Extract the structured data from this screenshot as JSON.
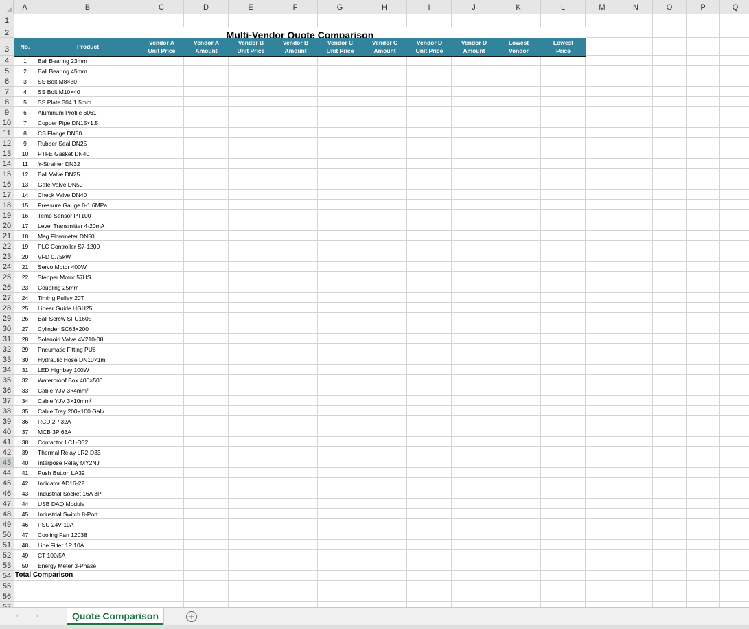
{
  "sheet": {
    "title": "Multi-Vendor Quote Comparison",
    "column_letters": [
      "A",
      "B",
      "C",
      "D",
      "E",
      "F",
      "G",
      "H",
      "I",
      "J",
      "K",
      "L",
      "M",
      "N",
      "O",
      "P",
      "Q"
    ],
    "selected_row": "43",
    "headers": [
      {
        "line1": "No.",
        "line2": ""
      },
      {
        "line1": "Product",
        "line2": ""
      },
      {
        "line1": "Vendor A",
        "line2": "Unit Price"
      },
      {
        "line1": "Vendor A",
        "line2": "Amount"
      },
      {
        "line1": "Vendor B",
        "line2": "Unit Price"
      },
      {
        "line1": "Vendor B",
        "line2": "Amount"
      },
      {
        "line1": "Vendor C",
        "line2": "Unit Price"
      },
      {
        "line1": "Vendor C",
        "line2": "Amount"
      },
      {
        "line1": "Vendor D",
        "line2": "Unit Price"
      },
      {
        "line1": "Vendor D",
        "line2": "Amount"
      },
      {
        "line1": "Lowest",
        "line2": "Vendor"
      },
      {
        "line1": "Lowest",
        "line2": "Price"
      }
    ],
    "products": [
      {
        "no": "1",
        "name": "Ball Bearing 23mm"
      },
      {
        "no": "2",
        "name": "Ball Bearing 45mm"
      },
      {
        "no": "3",
        "name": "SS Bolt M8×30"
      },
      {
        "no": "4",
        "name": "SS Bolt M10×40"
      },
      {
        "no": "5",
        "name": "SS Plate 304 1.5mm"
      },
      {
        "no": "6",
        "name": "Aluminum Profile 6061"
      },
      {
        "no": "7",
        "name": "Copper Pipe DN15×1.5"
      },
      {
        "no": "8",
        "name": "CS Flange DN50"
      },
      {
        "no": "9",
        "name": "Rubber Seal DN25"
      },
      {
        "no": "10",
        "name": "PTFE Gasket DN40"
      },
      {
        "no": "11",
        "name": "Y-Strainer DN32"
      },
      {
        "no": "12",
        "name": "Ball Valve DN25"
      },
      {
        "no": "13",
        "name": "Gate Valve DN50"
      },
      {
        "no": "14",
        "name": "Check Valve DN40"
      },
      {
        "no": "15",
        "name": "Pressure Gauge 0-1.6MPa"
      },
      {
        "no": "16",
        "name": "Temp Sensor PT100"
      },
      {
        "no": "17",
        "name": "Level Transmitter 4-20mA"
      },
      {
        "no": "18",
        "name": "Mag Flowmeter DN50"
      },
      {
        "no": "19",
        "name": "PLC Controller S7-1200"
      },
      {
        "no": "20",
        "name": "VFD 0.75kW"
      },
      {
        "no": "21",
        "name": "Servo Motor 400W"
      },
      {
        "no": "22",
        "name": "Stepper Motor 57HS"
      },
      {
        "no": "23",
        "name": "Coupling 25mm"
      },
      {
        "no": "24",
        "name": "Timing Pulley 20T"
      },
      {
        "no": "25",
        "name": "Linear Guide HGH25"
      },
      {
        "no": "26",
        "name": "Ball Screw SFU1605"
      },
      {
        "no": "27",
        "name": "Cylinder SC63×200"
      },
      {
        "no": "28",
        "name": "Solenoid Valve 4V210-08"
      },
      {
        "no": "29",
        "name": "Pneumatic Fitting PU8"
      },
      {
        "no": "30",
        "name": "Hydraulic Hose DN10×1m"
      },
      {
        "no": "31",
        "name": "LED Highbay 100W"
      },
      {
        "no": "32",
        "name": "Waterproof Box 400×500"
      },
      {
        "no": "33",
        "name": "Cable YJV 3×4mm²"
      },
      {
        "no": "34",
        "name": "Cable YJV 3×10mm²"
      },
      {
        "no": "35",
        "name": "Cable Tray 200×100 Galv."
      },
      {
        "no": "36",
        "name": "RCD 2P 32A"
      },
      {
        "no": "37",
        "name": "MCB 3P 63A"
      },
      {
        "no": "38",
        "name": "Contactor LC1-D32"
      },
      {
        "no": "39",
        "name": "Thermal Relay LR2-D33"
      },
      {
        "no": "40",
        "name": "Interpose Relay MY2NJ"
      },
      {
        "no": "41",
        "name": "Push Button LA39"
      },
      {
        "no": "42",
        "name": "Indicator AD16-22"
      },
      {
        "no": "43",
        "name": "Industrial Socket 16A 3P"
      },
      {
        "no": "44",
        "name": "USB DAQ Module"
      },
      {
        "no": "45",
        "name": "Industrial Switch 8-Port"
      },
      {
        "no": "46",
        "name": "PSU 24V 10A"
      },
      {
        "no": "47",
        "name": "Cooling Fan 12038"
      },
      {
        "no": "48",
        "name": "Line Filter 1P 10A"
      },
      {
        "no": "49",
        "name": "CT 100/5A"
      },
      {
        "no": "50",
        "name": "Energy Meter 3-Phase"
      }
    ],
    "total_label": "Total Comparison",
    "visible_row_numbers": [
      "1",
      "2",
      "3",
      "4",
      "5",
      "6",
      "7",
      "8",
      "9",
      "10",
      "11",
      "12",
      "13",
      "14",
      "15",
      "16",
      "17",
      "18",
      "19",
      "20",
      "21",
      "22",
      "23",
      "24",
      "25",
      "26",
      "27",
      "28",
      "29",
      "30",
      "31",
      "32",
      "33",
      "34",
      "35",
      "36",
      "37",
      "38",
      "39",
      "40",
      "41",
      "42",
      "43",
      "44",
      "45",
      "46",
      "47",
      "48",
      "49",
      "50",
      "51",
      "52",
      "53",
      "54",
      "55",
      "56",
      "57"
    ]
  },
  "tabs": {
    "active_sheet": "Quote Comparison",
    "prev_icon": "‹",
    "next_icon": "›",
    "add_icon": "+"
  },
  "colors": {
    "header_band": "#31849b",
    "header_text": "#ffffff",
    "active_tab": "#217346"
  }
}
